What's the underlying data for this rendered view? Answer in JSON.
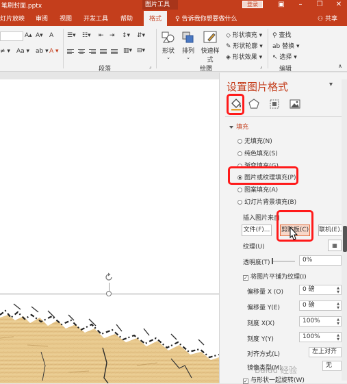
{
  "window": {
    "filename": "笔刷封面.pptx",
    "context_tab": "图片工具",
    "login": "登录"
  },
  "tabs": [
    "灯片放映",
    "审阅",
    "视图",
    "开发工具",
    "帮助",
    "格式"
  ],
  "active_tab": "格式",
  "tell_me": "告诉我你想要做什么",
  "share": "共享",
  "ribbon": {
    "paragraph_group": "段落",
    "drawing_group": "绘图",
    "editing_group": "编辑",
    "shape_btn": "形状",
    "arrange_btn": "排列",
    "quickstyle_btn": "快速样式",
    "shape_fill": "形状填充",
    "shape_outline": "形状轮廓",
    "shape_effects": "形状效果",
    "find": "查找",
    "replace": "替换",
    "select": "选择"
  },
  "pane": {
    "title": "设置图片格式",
    "section_fill": "填充",
    "fill_options": [
      {
        "label": "无填充(N)",
        "checked": false
      },
      {
        "label": "纯色填充(S)",
        "checked": false
      },
      {
        "label": "渐变填充(G)",
        "checked": false
      },
      {
        "label": "图片或纹理填充(P)",
        "checked": true
      },
      {
        "label": "图案填充(A)",
        "checked": false
      },
      {
        "label": "幻灯片背景填充(B)",
        "checked": false
      }
    ],
    "insert_from": "插入图片来自",
    "btn_file": "文件(F)...",
    "btn_clipboard": "剪贴板(C)",
    "btn_online": "联机(E)...",
    "texture_label": "纹理(U)",
    "transparency_label": "透明度(T)",
    "transparency_value": "0%",
    "tile_checkbox": "将图片平铺为纹理(I)",
    "offset_x_label": "偏移量 X (O)",
    "offset_x_value": "0 磅",
    "offset_y_label": "偏移量 Y(E)",
    "offset_y_value": "0 磅",
    "scale_x_label": "刻度 X(X)",
    "scale_x_value": "100%",
    "scale_y_label": "刻度 Y(Y)",
    "scale_y_value": "100%",
    "align_label": "对齐方式(L)",
    "align_value": "左上对齐",
    "mirror_label": "镜像类型(M)",
    "mirror_value": "无",
    "rotate_checkbox": "与形状一起旋转(W)"
  },
  "watermark": "Baidu 经验",
  "colors": {
    "accent": "#c43e1c",
    "highlight": "#ff1a1a"
  }
}
